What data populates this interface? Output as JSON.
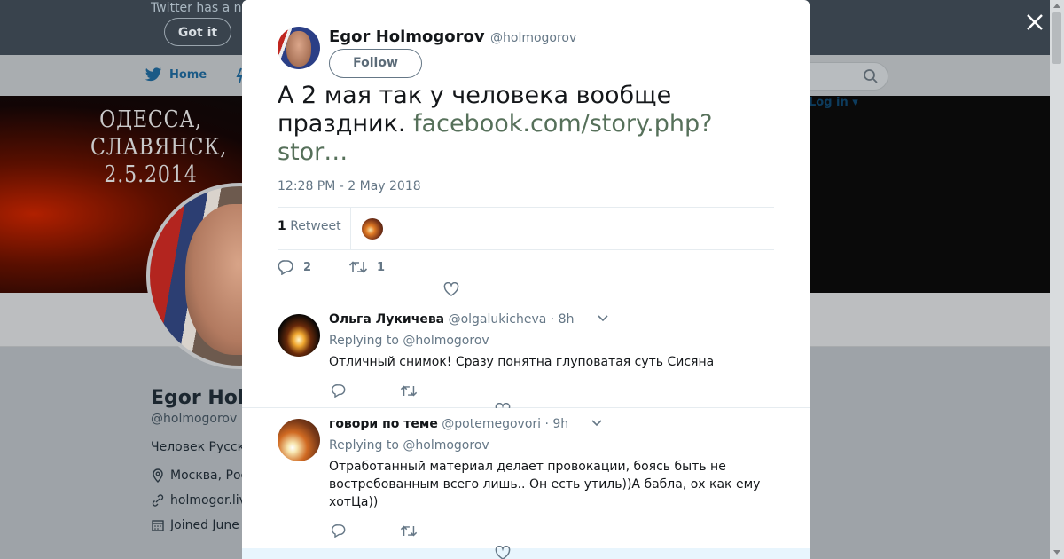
{
  "background_page": {
    "banner_message": "Twitter has a n",
    "got_it_label": "Got it",
    "nav": {
      "home_label": "Home",
      "login_label": "Log in"
    },
    "header_text_lines": [
      "ОДЕССА,",
      "СЛАВЯНСК,",
      "2.5.2014"
    ],
    "profile": {
      "name": "Egor Holm",
      "handle": "@holmogorov",
      "bio": "Человек Русск",
      "location": "Москва, Рос",
      "website": "holmogor.liv",
      "joined": "Joined June"
    }
  },
  "modal": {
    "author": {
      "name": "Egor Holmogorov",
      "handle": "@holmogorov",
      "follow_label": "Follow"
    },
    "tweet_text": "А 2 мая так у человека вообще праздник. ",
    "tweet_link": "facebook.com/story.php?stor…",
    "timestamp": "12:28 PM - 2 May 2018",
    "retweet_count": "1",
    "retweet_label": "Retweet",
    "reply_count": "2",
    "retweet_action_count": "1",
    "replies": [
      {
        "name": "Ольга Лукичева",
        "handle": "@olgalukicheva",
        "time": "· 8h",
        "replying_prefix": "Replying to",
        "replying_to": "@holmogorov",
        "text": "Отличный снимок! Сразу понятна глуповатая суть Сисяна"
      },
      {
        "name": "говори по теме",
        "handle": "@potemegovori",
        "time": "· 9h",
        "replying_prefix": "Replying to",
        "replying_to": "@holmogorov",
        "text": "Отработанный материал делает провокации, боясь быть не востребованным всего лишь.. Он есть утиль))А бабла, ох как  ему хотЦа))"
      }
    ]
  },
  "colors": {
    "twitter_blue": "#1da1f2",
    "link_green": "#56705a",
    "secondary_text": "#657786"
  }
}
